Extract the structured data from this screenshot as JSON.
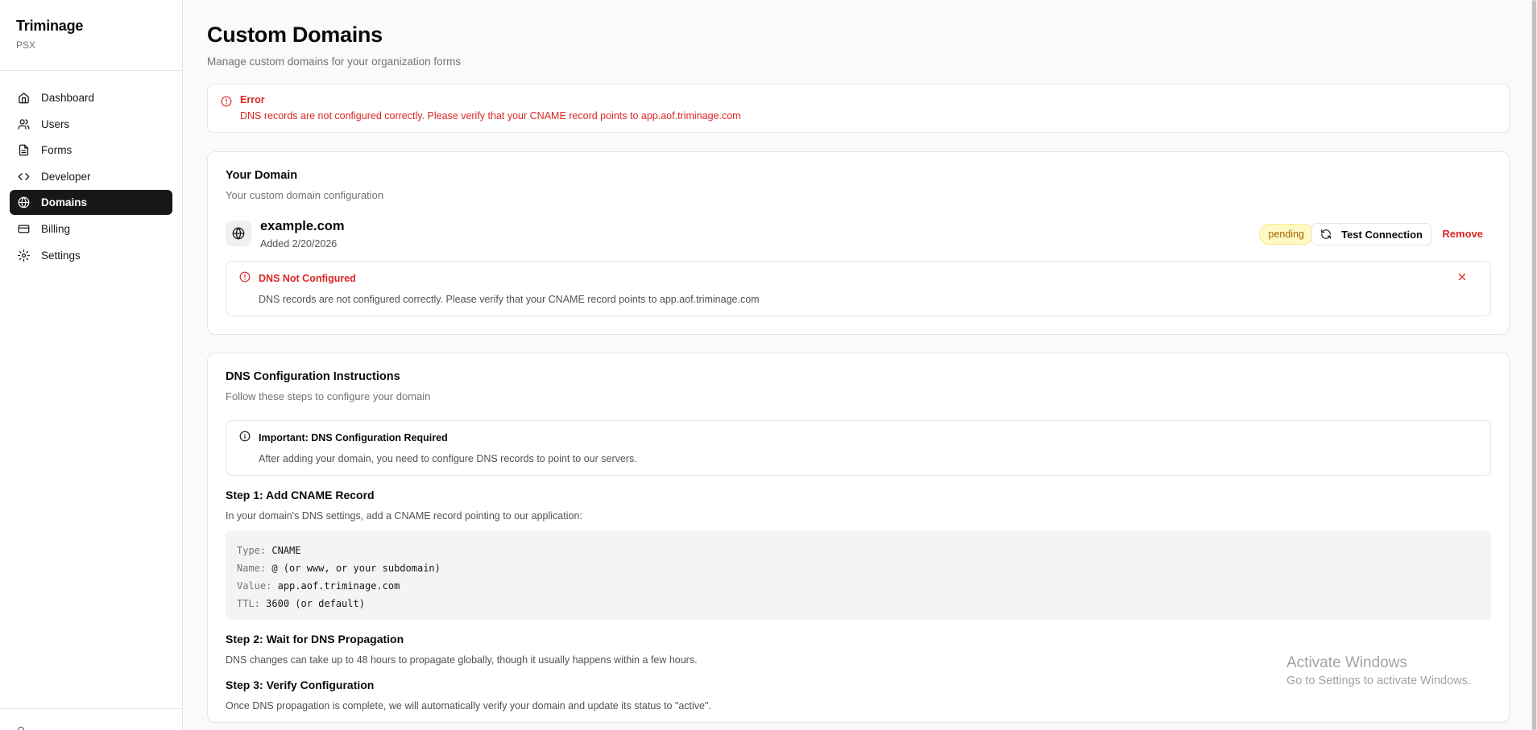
{
  "sidebar": {
    "brand": "Triminage",
    "org": "PSX",
    "items": [
      {
        "label": "Dashboard",
        "icon": "home-icon"
      },
      {
        "label": "Users",
        "icon": "users-icon"
      },
      {
        "label": "Forms",
        "icon": "file-text-icon"
      },
      {
        "label": "Developer",
        "icon": "code-icon"
      },
      {
        "label": "Domains",
        "icon": "globe-icon",
        "active": true
      },
      {
        "label": "Billing",
        "icon": "credit-card-icon"
      },
      {
        "label": "Settings",
        "icon": "gear-icon"
      }
    ]
  },
  "header": {
    "title": "Custom Domains",
    "subtitle": "Manage custom domains for your organization forms"
  },
  "error_alert": {
    "title": "Error",
    "message": "DNS records are not configured correctly. Please verify that your CNAME record points to app.aof.triminage.com"
  },
  "domain_card": {
    "title": "Your Domain",
    "description": "Your custom domain configuration",
    "domain": "example.com",
    "added": "Added 2/20/2026",
    "status": "pending",
    "test_label": "Test Connection",
    "remove_label": "Remove",
    "dns_alert": {
      "title": "DNS Not Configured",
      "message": "DNS records are not configured correctly. Please verify that your CNAME record points to app.aof.triminage.com"
    }
  },
  "instructions": {
    "title": "DNS Configuration Instructions",
    "description": "Follow these steps to configure your domain",
    "important": {
      "title": "Important: DNS Configuration Required",
      "message": "After adding your domain, you need to configure DNS records to point to our servers."
    },
    "step1": {
      "title": "Step 1: Add CNAME Record",
      "text": "In your domain's DNS settings, add a CNAME record pointing to our application:",
      "code": [
        {
          "key": "Type:",
          "value": "CNAME"
        },
        {
          "key": "Name:",
          "value": "@ (or www, or your subdomain)"
        },
        {
          "key": "Value:",
          "value": "app.aof.triminage.com"
        },
        {
          "key": "TTL:",
          "value": "3600 (or default)"
        }
      ]
    },
    "step2": {
      "title": "Step 2: Wait for DNS Propagation",
      "text": "DNS changes can take up to 48 hours to propagate globally, though it usually happens within a few hours."
    },
    "step3": {
      "title": "Step 3: Verify Configuration",
      "text": "Once DNS propagation is complete, we will automatically verify your domain and update its status to \"active\"."
    }
  },
  "watermark": {
    "line1": "Activate Windows",
    "line2": "Go to Settings to activate Windows."
  },
  "colors": {
    "accent": "#171717",
    "error": "#dc2626",
    "pending_bg": "#fef9c3",
    "pending_text": "#a16207"
  }
}
